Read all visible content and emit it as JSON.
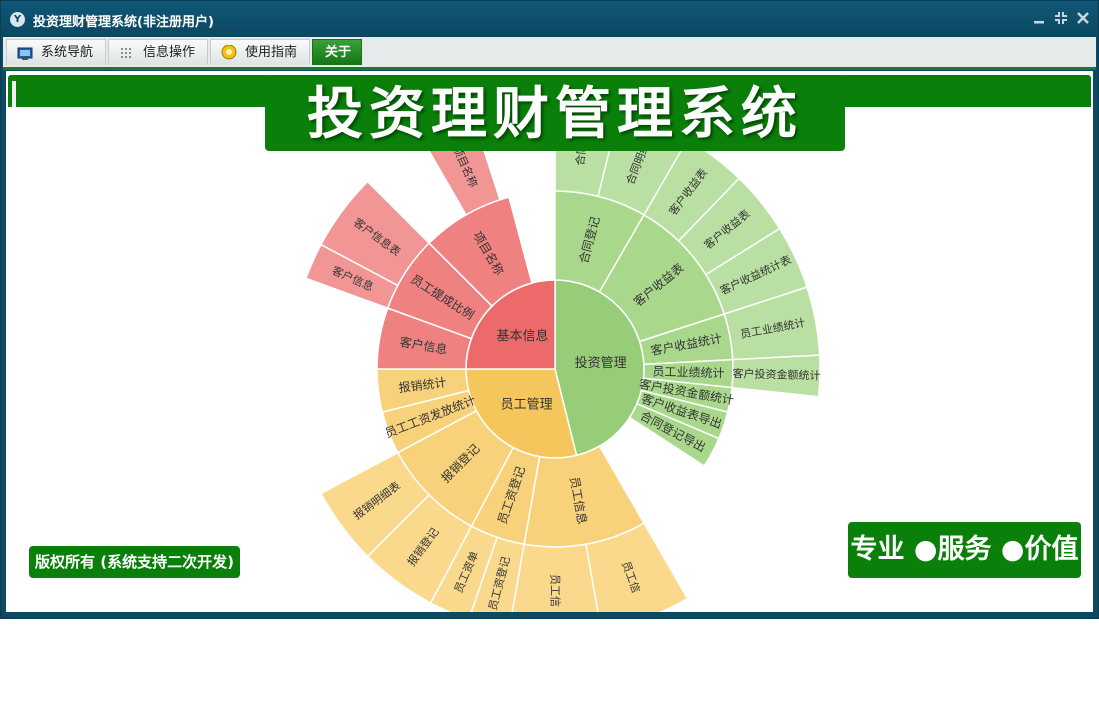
{
  "window": {
    "title": "投资理财管理系统(非注册用户)",
    "icon": "app-logo-icon",
    "controls": [
      "minimize-icon",
      "restore-icon",
      "close-icon"
    ]
  },
  "menu": {
    "tabs": [
      {
        "label": "系统导航",
        "icon": "monitor-icon"
      },
      {
        "label": "信息操作",
        "icon": "grid-icon"
      },
      {
        "label": "使用指南",
        "icon": "help-icon"
      },
      {
        "label": "关于",
        "icon": ""
      }
    ],
    "active_tab": "关于"
  },
  "banner": {
    "title": "投资理财管理系统"
  },
  "sunburst": {
    "root": [
      {
        "label": "投资管理",
        "color": "#97cc79",
        "children": [
          {
            "label": "合同登记",
            "children": [
              {
                "label": "合同登",
                "children": []
              },
              {
                "label": "合同明细",
                "children": []
              }
            ]
          },
          {
            "label": "客户收益表",
            "children": [
              {
                "label": "客户收益表",
                "children": []
              },
              {
                "label": "客户收益表",
                "children": []
              },
              {
                "label": "客户收益统计表",
                "children": []
              }
            ]
          },
          {
            "label": "客户收益统计",
            "children": [
              {
                "label": "员工业绩统计",
                "children": []
              }
            ]
          },
          {
            "label": "员工业绩统计",
            "children": [
              {
                "label": "客户投资金额统计",
                "children": []
              }
            ]
          },
          {
            "label": "客户投资金额统计",
            "children": []
          },
          {
            "label": "客户收益表导出",
            "children": []
          },
          {
            "label": "合同登记导出",
            "children": []
          }
        ]
      },
      {
        "label": "员工管理",
        "color": "#f5c65c",
        "children": [
          {
            "label": "员工信息",
            "children": [
              {
                "label": "员工信",
                "children": []
              },
              {
                "label": "员工信",
                "children": []
              }
            ]
          },
          {
            "label": "员工资登记",
            "children": [
              {
                "label": "员工资登记",
                "children": []
              },
              {
                "label": "员工资单",
                "children": []
              }
            ]
          },
          {
            "label": "报销登记",
            "children": [
              {
                "label": "报销登记",
                "children": []
              },
              {
                "label": "报销明细表",
                "children": []
              }
            ]
          },
          {
            "label": "员工工资发放统计",
            "children": []
          },
          {
            "label": "报销统计",
            "children": []
          }
        ]
      },
      {
        "label": "基本信息",
        "color": "#ec6a6a",
        "children": [
          {
            "label": "客户信息",
            "children": [
              {
                "label": "客户信息",
                "children": []
              },
              {
                "label": "客户信息表",
                "children": []
              }
            ]
          },
          {
            "label": "员工提成比例",
            "children": []
          },
          {
            "label": "项目名称",
            "children": [
              {
                "label": "项目名称",
                "children": []
              }
            ]
          }
        ]
      }
    ]
  },
  "footer": {
    "copyright": "版权所有 (系统支持二次开发)",
    "slogan": "专业 ●服务 ●价值"
  }
}
